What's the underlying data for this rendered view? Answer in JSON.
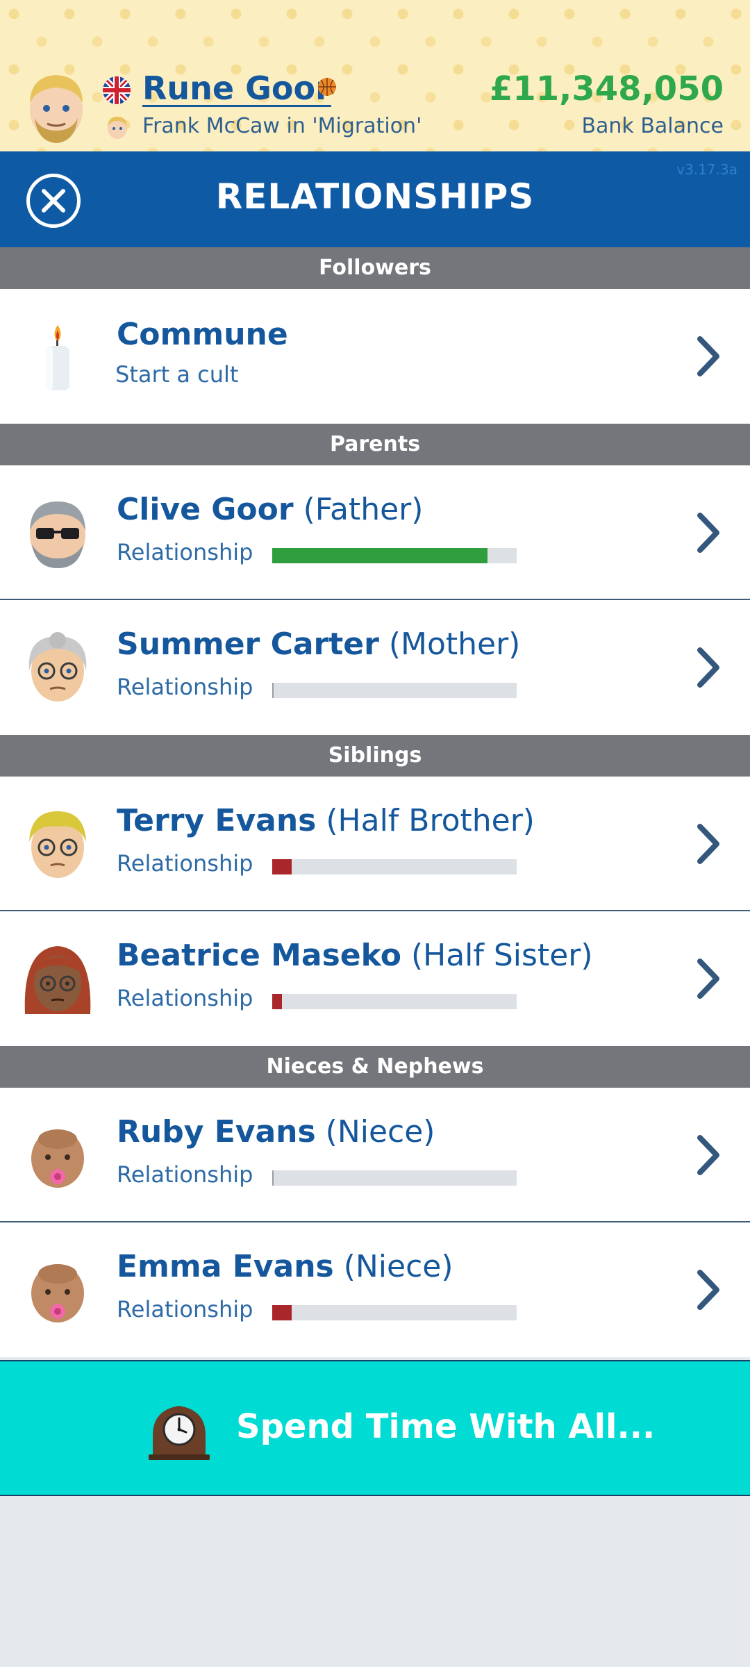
{
  "header": {
    "player_name": "Rune Goor",
    "job_text": "Frank McCaw in 'Migration'",
    "balance": "£11,348,050",
    "balance_label": "Bank Balance"
  },
  "titlebar": {
    "title": "RELATIONSHIPS",
    "version": "v3.17.3a"
  },
  "sections": {
    "followers": "Followers",
    "parents": "Parents",
    "siblings": "Siblings",
    "nieces": "Nieces & Nephews"
  },
  "commune": {
    "title": "Commune",
    "subtitle": "Start a cult"
  },
  "relationship_label": "Relationship",
  "people": [
    {
      "name": "Clive Goor",
      "relation": "(Father)",
      "relationship": 0.88,
      "bar_color": "#2e9e3e"
    },
    {
      "name": "Summer Carter",
      "relation": "(Mother)",
      "relationship": 0.0,
      "bar_color": "#a9262a"
    },
    {
      "name": "Terry Evans",
      "relation": "(Half Brother)",
      "relationship": 0.08,
      "bar_color": "#a9262a"
    },
    {
      "name": "Beatrice Maseko",
      "relation": "(Half Sister)",
      "relationship": 0.04,
      "bar_color": "#a9262a"
    },
    {
      "name": "Ruby Evans",
      "relation": "(Niece)",
      "relationship": 0.0,
      "bar_color": "#a9262a"
    },
    {
      "name": "Emma Evans",
      "relation": "(Niece)",
      "relationship": 0.08,
      "bar_color": "#a9262a"
    }
  ],
  "spend_time": {
    "label": "Spend Time With All..."
  },
  "icons": {
    "close": "close-icon",
    "flag": "uk-flag-icon",
    "ball": "basketball-icon",
    "candle": "candle-icon",
    "chevron": "chevron-right-icon",
    "clock": "mantel-clock-icon"
  },
  "colors": {
    "header_bg": "#fbefc1",
    "titlebar_bg": "#0f5aa5",
    "section_bg": "#74767c",
    "name_color": "#15579c",
    "balance_color": "#2ea84a",
    "spend_bg": "#00dbd3"
  }
}
